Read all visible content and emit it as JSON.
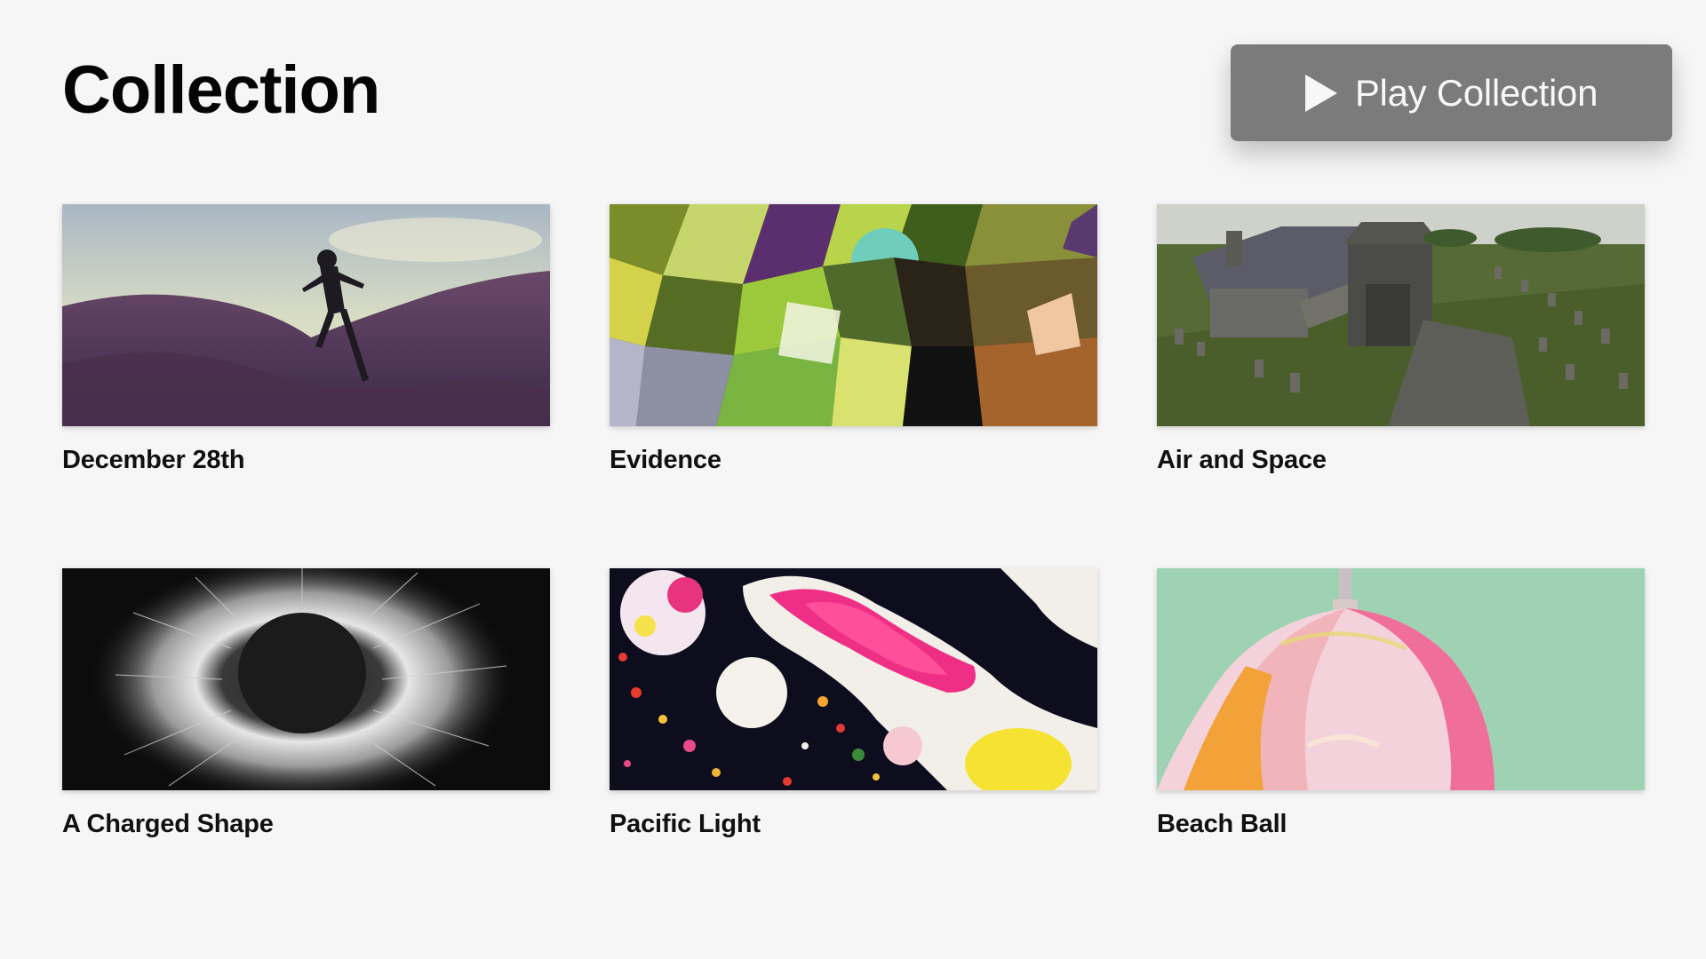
{
  "header": {
    "title": "Collection",
    "play_label": "Play Collection",
    "play_icon": "play-icon"
  },
  "collection": {
    "items": [
      {
        "title": "December 28th"
      },
      {
        "title": "Evidence"
      },
      {
        "title": "Air and Space"
      },
      {
        "title": "A Charged Shape"
      },
      {
        "title": "Pacific Light"
      },
      {
        "title": "Beach Ball"
      }
    ]
  },
  "colors": {
    "background": "#f6f6f6",
    "button": "#7b7b7b",
    "button_text": "#f7f7f7",
    "title_text": "#050505"
  }
}
